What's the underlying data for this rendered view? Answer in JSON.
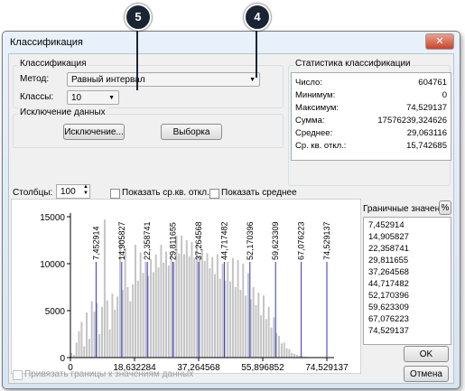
{
  "window": {
    "title": "Классификация",
    "close": "✕"
  },
  "callouts": [
    "5",
    "4"
  ],
  "classification": {
    "group_label": "Классификация",
    "method_label": "Метод:",
    "method_value": "Равный интервал",
    "classes_label": "Классы:",
    "classes_value": "10"
  },
  "exclusion": {
    "group_label": "Исключение данных",
    "exclusion_button": "Исключение...",
    "sample_button": "Выборка"
  },
  "stats": {
    "group_label": "Статистика классификации",
    "rows": [
      {
        "label": "Число:",
        "value": "604761"
      },
      {
        "label": "Минимум:",
        "value": "0"
      },
      {
        "label": "Максимум:",
        "value": "74,529137"
      },
      {
        "label": "Сумма:",
        "value": "17576239,324626"
      },
      {
        "label": "Среднее:",
        "value": "29,063116"
      },
      {
        "label": "Ср. кв. откл.:",
        "value": "15,742685"
      }
    ]
  },
  "columns": {
    "label": "Столбцы:",
    "value": "100",
    "show_std_label": "Показать ср.кв. откл.",
    "show_mean_label": "Показать среднее"
  },
  "breaks": {
    "header": "Граничные значения",
    "percent_button": "%",
    "values": [
      "7,452914",
      "14,905827",
      "22,358741",
      "29,811655",
      "37,264568",
      "44,717482",
      "52,170396",
      "59,623309",
      "67,076223",
      "74,529137"
    ]
  },
  "snap_label": "Привязать границы к значениям данных",
  "ok_button": "OK",
  "cancel_button": "Отмена",
  "colors": {
    "histogram_bar": "#c4c4c4",
    "break_line": "#3333cc",
    "callout_bg": "#1a2533"
  },
  "chart_data": {
    "type": "bar",
    "title": "",
    "xlabel": "",
    "ylabel": "",
    "xlim": [
      0,
      74.529137
    ],
    "ylim": [
      0,
      15000
    ],
    "yticks": [
      "15000",
      "10000",
      "5000",
      "0"
    ],
    "xticks": [
      "0",
      "18,632284",
      "37,264568",
      "55,896852",
      "74,529137"
    ],
    "xtick_values": [
      0,
      18.632284,
      37.264568,
      55.896852,
      74.529137
    ],
    "break_values": [
      7.452914,
      14.905827,
      22.358741,
      29.811655,
      37.264568,
      44.717482,
      52.170396,
      59.623309,
      67.076223,
      74.529137
    ],
    "break_labels": [
      "7,452914",
      "14,905827",
      "22,358741",
      "29,811655",
      "37,264568",
      "44,717482",
      "52,170396",
      "59,623309",
      "67,076223",
      "74,529137"
    ],
    "bins": 100,
    "values": [
      500,
      300,
      1600,
      2800,
      3800,
      1200,
      4800,
      2000,
      6000,
      4900,
      5800,
      2500,
      5400,
      14700,
      6100,
      3000,
      6800,
      5100,
      6500,
      12500,
      7200,
      11700,
      7500,
      6000,
      7800,
      12000,
      8200,
      11200,
      9000,
      10200,
      8700,
      10500,
      9100,
      11000,
      9600,
      12000,
      10100,
      11300,
      9800,
      11000,
      10200,
      13000,
      11100,
      13000,
      11000,
      12500,
      10800,
      12300,
      10600,
      12100,
      10700,
      11500,
      10300,
      11100,
      9500,
      10700,
      8900,
      11000,
      8400,
      10000,
      8200,
      10200,
      8100,
      10600,
      7500,
      10400,
      7200,
      10000,
      6600,
      9000,
      6200,
      7500,
      5600,
      6900,
      4500,
      6600,
      4100,
      5400,
      3200,
      4300,
      2600,
      2300,
      1500,
      1600,
      1000,
      900,
      500,
      400,
      300,
      200,
      150,
      100,
      80,
      60,
      40,
      30,
      20,
      10,
      5,
      0
    ]
  }
}
